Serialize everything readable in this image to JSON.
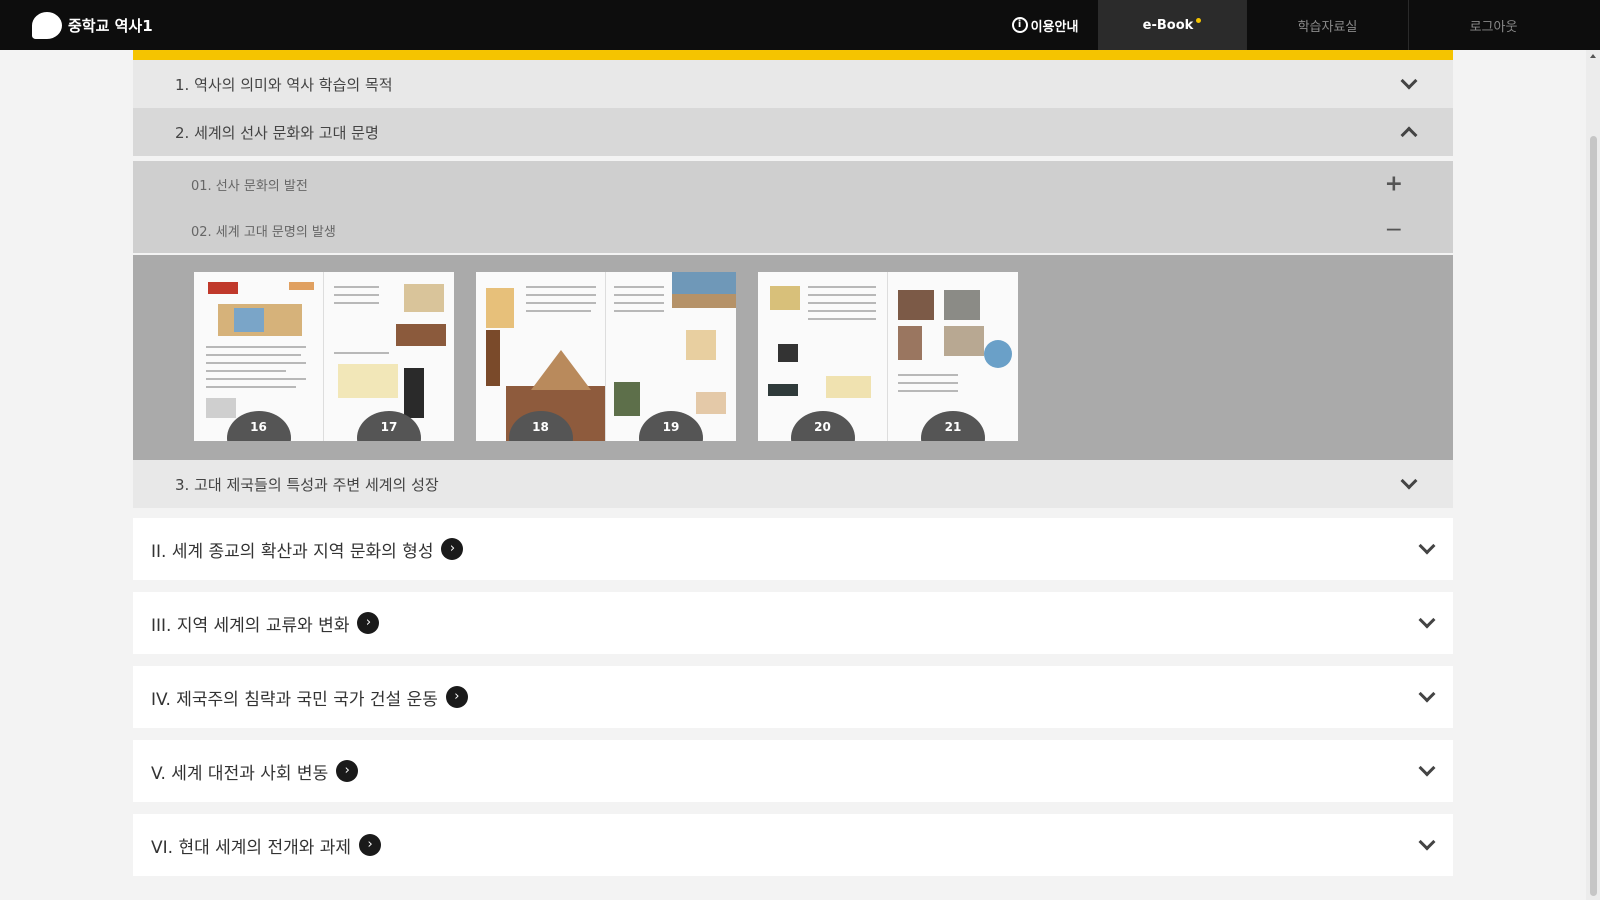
{
  "header": {
    "brand": "중학교 역사1",
    "nav": {
      "guide": "이용안내",
      "ebook": "e-Book",
      "resources": "학습자료실",
      "login": "로그아웃"
    }
  },
  "chapters": [
    {
      "label": "1. 역사의 의미와 역사 학습의 목적",
      "expanded": false
    },
    {
      "label": "2. 세계의 선사 문화와 고대 문명",
      "expanded": true
    },
    {
      "label": "3. 고대 제국들의 특성과 주변 세계의 성장",
      "expanded": false
    }
  ],
  "sections": [
    {
      "label": "01. 선사 문화의 발전",
      "expanded": false
    },
    {
      "label": "02. 세계 고대 문명의 발생",
      "expanded": true
    }
  ],
  "pages": [
    "16",
    "17",
    "18",
    "19",
    "20",
    "21"
  ],
  "units": [
    {
      "label": "II. 세계 종교의 확산과 지역 문화의 형성"
    },
    {
      "label": "III. 지역 세계의 교류와 변화"
    },
    {
      "label": "IV. 제국주의 침략과 국민 국가 건설 운동"
    },
    {
      "label": "V. 세계 대전과 사회 변동"
    },
    {
      "label": "VI. 현대 세계의 전개와 과제"
    }
  ],
  "colors": {
    "accent": "#f5c400",
    "topbar": "#0d0d0d"
  }
}
